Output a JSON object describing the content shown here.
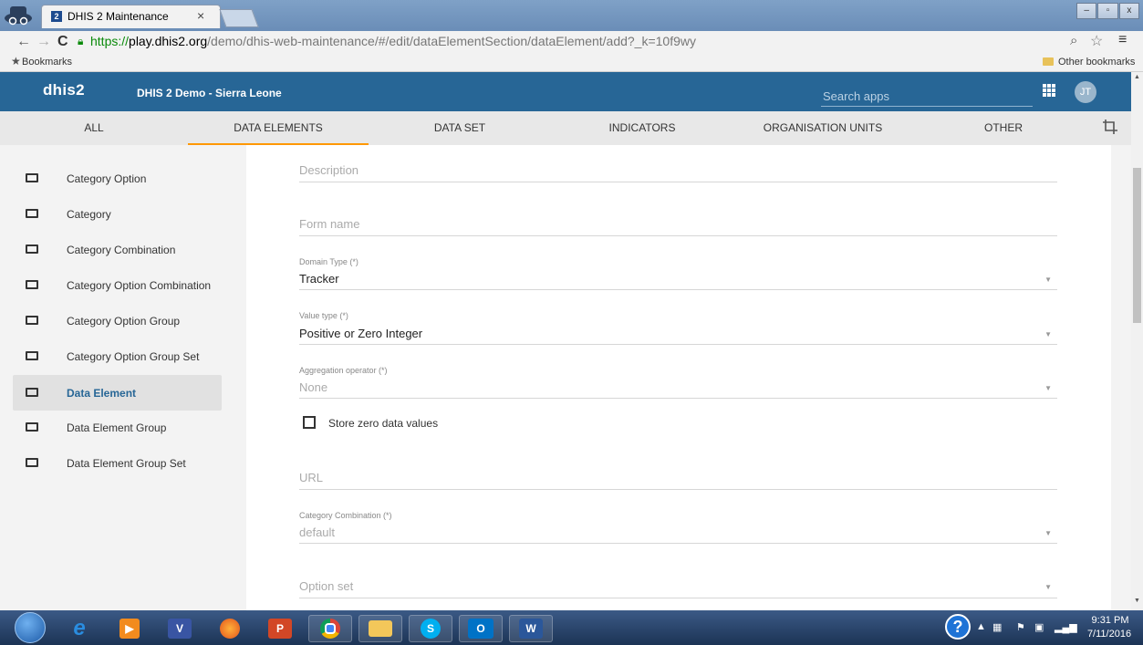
{
  "browser": {
    "tab_title": "DHIS 2 Maintenance",
    "tab_favicon": "2",
    "tab_close": "×",
    "url_scheme": "https://",
    "url_host": "play.dhis2.org",
    "url_path": "/demo/dhis-web-maintenance/#/edit/dataElementSection/dataElement/add?_k=10f9wy",
    "bookmarks_label": "Bookmarks",
    "other_bookmarks_label": "Other bookmarks",
    "window_controls": [
      "–",
      "▫",
      "x"
    ]
  },
  "header": {
    "logo": "dhis2",
    "instance_name": "DHIS 2 Demo - Sierra Leone",
    "search_placeholder": "Search apps",
    "avatar_initials": "JT"
  },
  "section_tabs": [
    {
      "label": "ALL"
    },
    {
      "label": "DATA ELEMENTS",
      "active": true
    },
    {
      "label": "DATA SET"
    },
    {
      "label": "INDICATORS"
    },
    {
      "label": "ORGANISATION UNITS"
    },
    {
      "label": "OTHER"
    }
  ],
  "sidebar": {
    "items": [
      {
        "label": "Category Option"
      },
      {
        "label": "Category"
      },
      {
        "label": "Category Combination"
      },
      {
        "label": "Category Option Combination"
      },
      {
        "label": "Category Option Group"
      },
      {
        "label": "Category Option Group Set"
      },
      {
        "label": "Data Element",
        "active": true
      },
      {
        "label": "Data Element Group"
      },
      {
        "label": "Data Element Group Set"
      }
    ]
  },
  "form": {
    "description_placeholder": "Description",
    "form_name_placeholder": "Form name",
    "domain_type_label": "Domain Type (*)",
    "domain_type_value": "Tracker",
    "value_type_label": "Value type (*)",
    "value_type_value": "Positive or Zero Integer",
    "aggregation_label": "Aggregation operator (*)",
    "aggregation_value": "None",
    "store_zero_label": "Store zero data values",
    "url_placeholder": "URL",
    "category_combo_label": "Category Combination (*)",
    "category_combo_value": "default",
    "option_set_placeholder": "Option set"
  },
  "taskbar": {
    "apps": [
      "ie",
      "media",
      "visio",
      "firefox",
      "powerpoint",
      "chrome",
      "explorer",
      "skype",
      "outlook",
      "word"
    ],
    "clock_time": "9:31 PM",
    "clock_date": "7/11/2016"
  },
  "colors": {
    "header_bg": "#276696",
    "active_tab_underline": "#ff9800",
    "active_sidebar_text": "#276696"
  }
}
